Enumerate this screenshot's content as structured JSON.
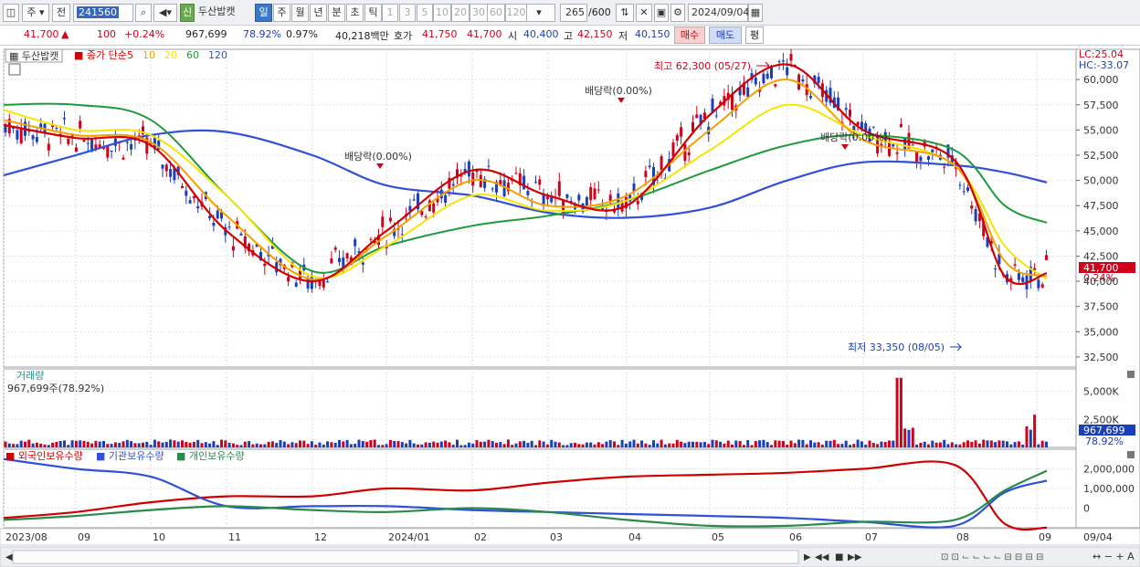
{
  "toolbar": {
    "market": "주",
    "period_sel": "전",
    "code": "241560",
    "badge": "신",
    "name": "두산밥캣",
    "period_tabs": [
      "일",
      "주",
      "월",
      "년",
      "분",
      "초",
      "틱"
    ],
    "nums": [
      "1",
      "3",
      "5",
      "10",
      "20",
      "30",
      "60",
      "120"
    ],
    "count": "265",
    "count_total": "/600",
    "date": "2024/09/04"
  },
  "quote": {
    "price": "41,700",
    "arrow": "▲",
    "change": "100",
    "rate": "+0.24%",
    "volume": "967,699",
    "vol_rate": "78.92%",
    "turnover": "0.97%",
    "amount": "40,218백만",
    "bid_label": "호가",
    "ask": "41,750",
    "bid": "41,700",
    "open_label": "시",
    "open": "40,400",
    "high_label": "고",
    "high": "42,150",
    "low_label": "저",
    "low": "40,150",
    "buy": "매수",
    "sell": "매도",
    "eval": "평"
  },
  "price_panel": {
    "name_tag": "두산밥캣",
    "legend_prefix": "종가 단순",
    "ma_labels": [
      "5",
      "10",
      "20",
      "60",
      "120"
    ],
    "ma_colors": [
      "#d40000",
      "#f5a000",
      "#f5e600",
      "#1f9a3a",
      "#3050d8"
    ],
    "lc": "LC:25.04",
    "hc": "HC:-33.07",
    "current_label": "41,700",
    "current_rate": "0.24%",
    "max_note": "최고 62,300 (05/27)",
    "min_note": "최저 33,350 (08/05)",
    "div_notes": [
      "배당락(0.00%)",
      "배당락(0.00%)",
      "배당락(0.00%)"
    ]
  },
  "volume_panel": {
    "title": "거래량",
    "info": "967,699주(78.92%)",
    "current": "967,699",
    "current_rate": "78.92%"
  },
  "holdings_panel": {
    "labels": [
      "외국인보유수량",
      "기관보유수량",
      "개인보유수량"
    ],
    "colors": [
      "#d00000",
      "#3050d8",
      "#2a8a4a"
    ]
  },
  "x_axis": [
    "2023/08",
    "09",
    "10",
    "11",
    "12",
    "2024/01",
    "02",
    "03",
    "04",
    "05",
    "06",
    "07",
    "08",
    "09",
    "09/04"
  ],
  "chart_data": [
    {
      "type": "line",
      "title": "두산밥캣",
      "y_unit": "원",
      "ylim": [
        31500,
        63000
      ],
      "y_ticks": [
        32500,
        35000,
        37500,
        40000,
        42500,
        45000,
        47500,
        50000,
        52500,
        55000,
        57500,
        60000
      ],
      "y_tick_labels": [
        "32,500",
        "35,000",
        "37,500",
        "40,000",
        "42,500",
        "45,000",
        "47,500",
        "50,000",
        "52,500",
        "55,000",
        "57,500",
        "60,000"
      ],
      "x": [
        "2023/08",
        "09",
        "10",
        "11",
        "12",
        "2024/01",
        "02",
        "03",
        "04",
        "05",
        "06",
        "07",
        "08",
        "09"
      ],
      "series": [
        {
          "name": "5",
          "values": [
            55500,
            54200,
            53500,
            45000,
            40000,
            45000,
            51000,
            48500,
            47500,
            56500,
            61500,
            55000,
            52000,
            40500,
            40800
          ]
        },
        {
          "name": "10",
          "values": [
            56000,
            54500,
            53800,
            46500,
            40200,
            44500,
            50000,
            47500,
            48500,
            55000,
            60000,
            54000,
            51500,
            42000,
            40500
          ]
        },
        {
          "name": "20",
          "values": [
            57000,
            55000,
            54500,
            48500,
            40500,
            43500,
            48500,
            47000,
            48000,
            53000,
            57500,
            54500,
            51500,
            43500,
            40200
          ]
        },
        {
          "name": "60",
          "values": [
            57500,
            57500,
            56000,
            48500,
            41000,
            43500,
            45500,
            46500,
            48000,
            51000,
            53500,
            54500,
            53000,
            47500,
            45800
          ]
        },
        {
          "name": "120",
          "values": [
            50500,
            52500,
            54500,
            54800,
            52500,
            49500,
            48500,
            46800,
            46300,
            47300,
            50000,
            51800,
            51500,
            50800,
            49800
          ]
        }
      ]
    },
    {
      "type": "bar",
      "title": "거래량",
      "ylim": [
        0,
        7000000
      ],
      "y_ticks": [
        2500000,
        5000000
      ],
      "y_tick_labels": [
        "2,500K",
        "5,000K"
      ],
      "last": 967699,
      "max": 6200000
    },
    {
      "type": "line",
      "title": "보유수량",
      "ylim": [
        -1000000,
        3000000
      ],
      "y_ticks": [
        0,
        1000000,
        2000000
      ],
      "y_tick_labels": [
        "0",
        "1,000,000",
        "2,000,000"
      ],
      "series": [
        {
          "name": "외국인보유수량",
          "values": [
            -500000,
            -200000,
            300000,
            600000,
            600000,
            1000000,
            900000,
            1300000,
            1600000,
            1700000,
            1800000,
            2000000,
            2200000,
            -800000,
            -1000000
          ]
        },
        {
          "name": "기관보유수량",
          "values": [
            2500000,
            2000000,
            1600000,
            100000,
            100000,
            100000,
            -100000,
            -200000,
            -300000,
            -400000,
            -500000,
            -700000,
            -900000,
            800000,
            1400000
          ]
        },
        {
          "name": "개인보유수량",
          "values": [
            -600000,
            -400000,
            -100000,
            100000,
            -100000,
            -200000,
            0,
            -200000,
            -600000,
            -900000,
            -900000,
            -700000,
            -600000,
            900000,
            1900000
          ]
        }
      ]
    }
  ]
}
